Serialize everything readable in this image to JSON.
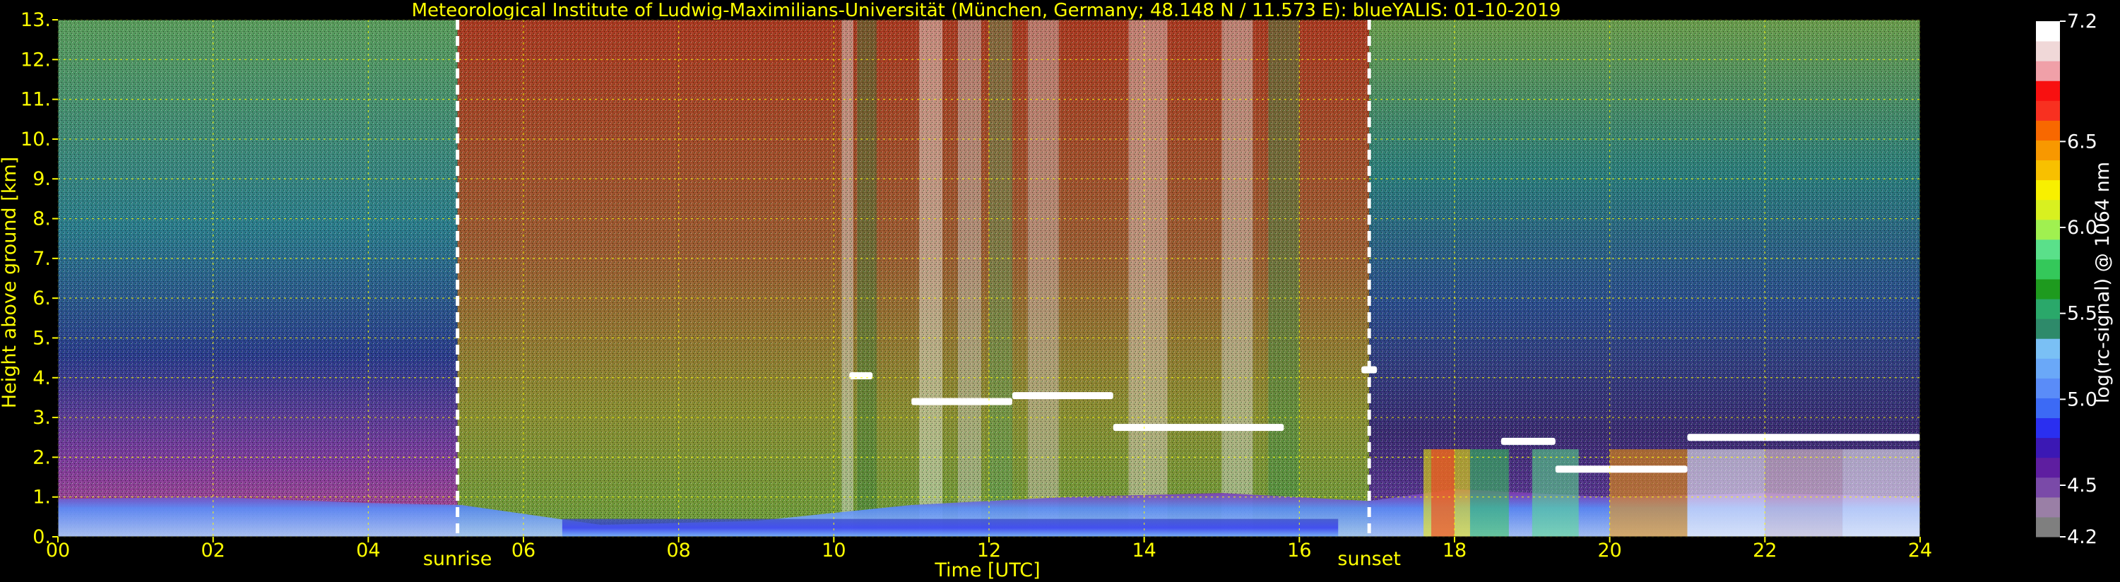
{
  "chart_data": {
    "type": "heatmap",
    "title": "Meteorological Institute of Ludwig-Maximilians-Universität (München, Germany; 48.148 N / 11.573 E):     blueYALIS: 01-10-2019",
    "xlabel": "Time [UTC]",
    "ylabel": "Height above ground [km]",
    "xlim": [
      0,
      24
    ],
    "ylim": [
      0,
      13
    ],
    "x_ticks": [
      "00",
      "02",
      "04",
      "06",
      "08",
      "10",
      "12",
      "14",
      "16",
      "18",
      "20",
      "22",
      "24"
    ],
    "y_ticks": [
      "0.",
      "1.",
      "2.",
      "3.",
      "4.",
      "5.",
      "6.",
      "7.",
      "8.",
      "9.",
      "10.",
      "11.",
      "12.",
      "13."
    ],
    "grid": true,
    "markers": [
      {
        "label": "sunrise",
        "x": 5.15
      },
      {
        "label": "sunset",
        "x": 16.9
      }
    ],
    "colorbar": {
      "label": "log(rc-signal) @ 1064 nm",
      "range": [
        4.2,
        7.2
      ],
      "ticks": [
        "4.2",
        "4.5",
        "5.0",
        "5.5",
        "6.0",
        "6.5",
        "7.2"
      ],
      "tick_values": [
        4.2,
        4.5,
        5.0,
        5.5,
        6.0,
        6.5,
        7.2
      ],
      "colors": [
        "#7f7f7f",
        "#9a7fa6",
        "#7a4aa8",
        "#5e1ea0",
        "#3b18b4",
        "#2a2ff0",
        "#3c6af5",
        "#5a8cf8",
        "#6aa8f8",
        "#7ac0f5",
        "#2e8a6a",
        "#2aa86a",
        "#1e9a1e",
        "#34c85a",
        "#5ae08a",
        "#a0f050",
        "#d8f020",
        "#f8f000",
        "#f8c000",
        "#f89800",
        "#f86800",
        "#f83020",
        "#f81010",
        "#f0a0a8",
        "#f0d8d8",
        "#ffffff"
      ]
    },
    "aerosol_layer_top_km": [
      {
        "x": 0.0,
        "y": 0.95
      },
      {
        "x": 2.0,
        "y": 1.0
      },
      {
        "x": 4.0,
        "y": 0.85
      },
      {
        "x": 5.2,
        "y": 0.8
      },
      {
        "x": 7.0,
        "y": 0.3
      },
      {
        "x": 9.0,
        "y": 0.4
      },
      {
        "x": 11.0,
        "y": 0.8
      },
      {
        "x": 13.0,
        "y": 1.0
      },
      {
        "x": 15.0,
        "y": 1.1
      },
      {
        "x": 16.9,
        "y": 0.9
      },
      {
        "x": 18.0,
        "y": 1.2
      },
      {
        "x": 20.0,
        "y": 1.0
      },
      {
        "x": 22.0,
        "y": 1.1
      },
      {
        "x": 24.0,
        "y": 1.0
      }
    ],
    "cloud_layers_km": [
      {
        "x_start": 10.2,
        "x_end": 10.5,
        "y": 4.05
      },
      {
        "x_start": 11.0,
        "x_end": 12.3,
        "y": 3.4
      },
      {
        "x_start": 12.3,
        "x_end": 13.6,
        "y": 3.55
      },
      {
        "x_start": 13.6,
        "x_end": 15.8,
        "y": 2.75
      },
      {
        "x_start": 16.8,
        "x_end": 17.0,
        "y": 4.2
      },
      {
        "x_start": 18.6,
        "x_end": 19.3,
        "y": 2.4
      },
      {
        "x_start": 19.3,
        "x_end": 21.0,
        "y": 1.7
      },
      {
        "x_start": 21.0,
        "x_end": 24.0,
        "y": 2.5
      }
    ]
  }
}
